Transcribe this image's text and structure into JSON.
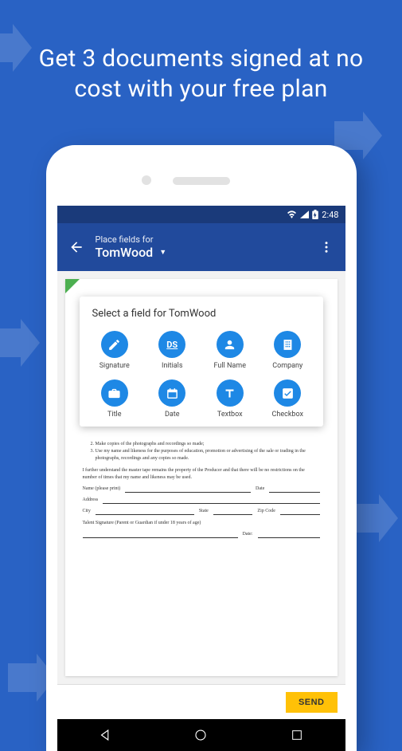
{
  "headline": "Get 3 documents signed at no cost with your free plan",
  "status": {
    "time": "2:48"
  },
  "appbar": {
    "subtitle": "Place fields for",
    "title": "TomWood"
  },
  "popover": {
    "title": "Select a field for TomWood",
    "fields": [
      {
        "key": "signature",
        "label": "Signature"
      },
      {
        "key": "initials",
        "label": "Initials"
      },
      {
        "key": "fullname",
        "label": "Full Name"
      },
      {
        "key": "company",
        "label": "Company"
      },
      {
        "key": "title",
        "label": "Title"
      },
      {
        "key": "date",
        "label": "Date"
      },
      {
        "key": "textbox",
        "label": "Textbox"
      },
      {
        "key": "checkbox",
        "label": "Checkbox"
      }
    ]
  },
  "document": {
    "list_items": [
      "Make copies of the photographs and recordings so made;",
      "Use my name and likeness for the purposes of education, promotion or advertising of the sale or trading in the photographs, recordings and any copies so made."
    ],
    "paragraph": "I further understand the master tape remains the property of the Producer and that there will be no restrictions on the number of times that my name and likeness may be used.",
    "fields": {
      "name": "Name (please print)",
      "date": "Date",
      "address": "Address",
      "city": "City",
      "state": "State",
      "zip": "Zip Code",
      "signature": "Talent Signature (Parent or Guardian if under 18 years of age)",
      "date2": "Date:"
    }
  },
  "actions": {
    "send": "SEND"
  }
}
